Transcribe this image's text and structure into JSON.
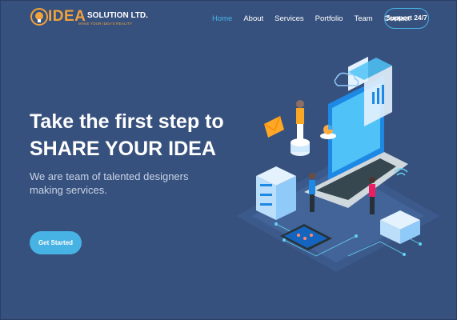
{
  "brand": {
    "name": "IDEA",
    "suffix": "SOLUTION LTD.",
    "tagline": "MAKE YOUR IDEA'S REALITY",
    "accent": "#f2a23a"
  },
  "nav": {
    "items": [
      {
        "label": "Home",
        "active": true
      },
      {
        "label": "About"
      },
      {
        "label": "Services"
      },
      {
        "label": "Portfolio"
      },
      {
        "label": "Team"
      },
      {
        "label": "Contact"
      }
    ],
    "support_label": "Support 24/7"
  },
  "hero": {
    "title_line1": "Take the first step to",
    "title_line2": "SHARE YOUR IDEA",
    "subtitle": "We are team of talented designers making services.",
    "cta_label": "Get Started"
  },
  "colors": {
    "background": "#37517e",
    "accent": "#47b2e4",
    "brand_orange": "#f2a23a"
  },
  "illustration": {
    "icon": "isometric-it-services-illustration"
  }
}
